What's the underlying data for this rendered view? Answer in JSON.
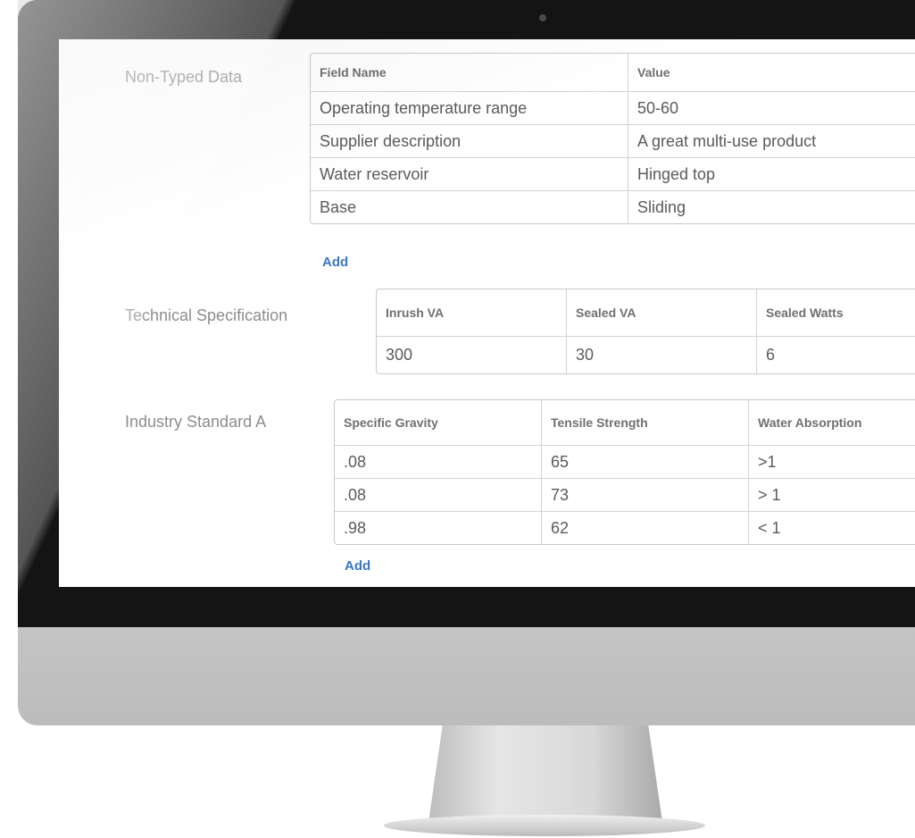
{
  "non_typed": {
    "label": "Non-Typed Data",
    "headers": [
      "Field Name",
      "Value"
    ],
    "rows": [
      [
        "Operating temperature range",
        "50-60"
      ],
      [
        "Supplier description",
        "A great multi-use product"
      ],
      [
        "Water reservoir",
        "Hinged top"
      ],
      [
        "Base",
        "Sliding"
      ]
    ],
    "add_label": "Add"
  },
  "tech_spec": {
    "label": "Technical Specification",
    "headers": [
      "Inrush VA",
      "Sealed VA",
      "Sealed Watts"
    ],
    "rows": [
      [
        "300",
        "30",
        "6"
      ]
    ]
  },
  "industry": {
    "label": "Industry Standard A",
    "headers": [
      "Specific Gravity",
      "Tensile Strength",
      "Water Absorption"
    ],
    "rows": [
      [
        ".08",
        "65",
        ">1"
      ],
      [
        ".08",
        "73",
        "> 1"
      ],
      [
        ".98",
        "62",
        "< 1"
      ]
    ],
    "add_label": "Add"
  },
  "colors": {
    "bezel": "#141414",
    "label_text": "#8d8d8d",
    "link": "#3a78c4",
    "table_border": "#c9c9c9"
  }
}
